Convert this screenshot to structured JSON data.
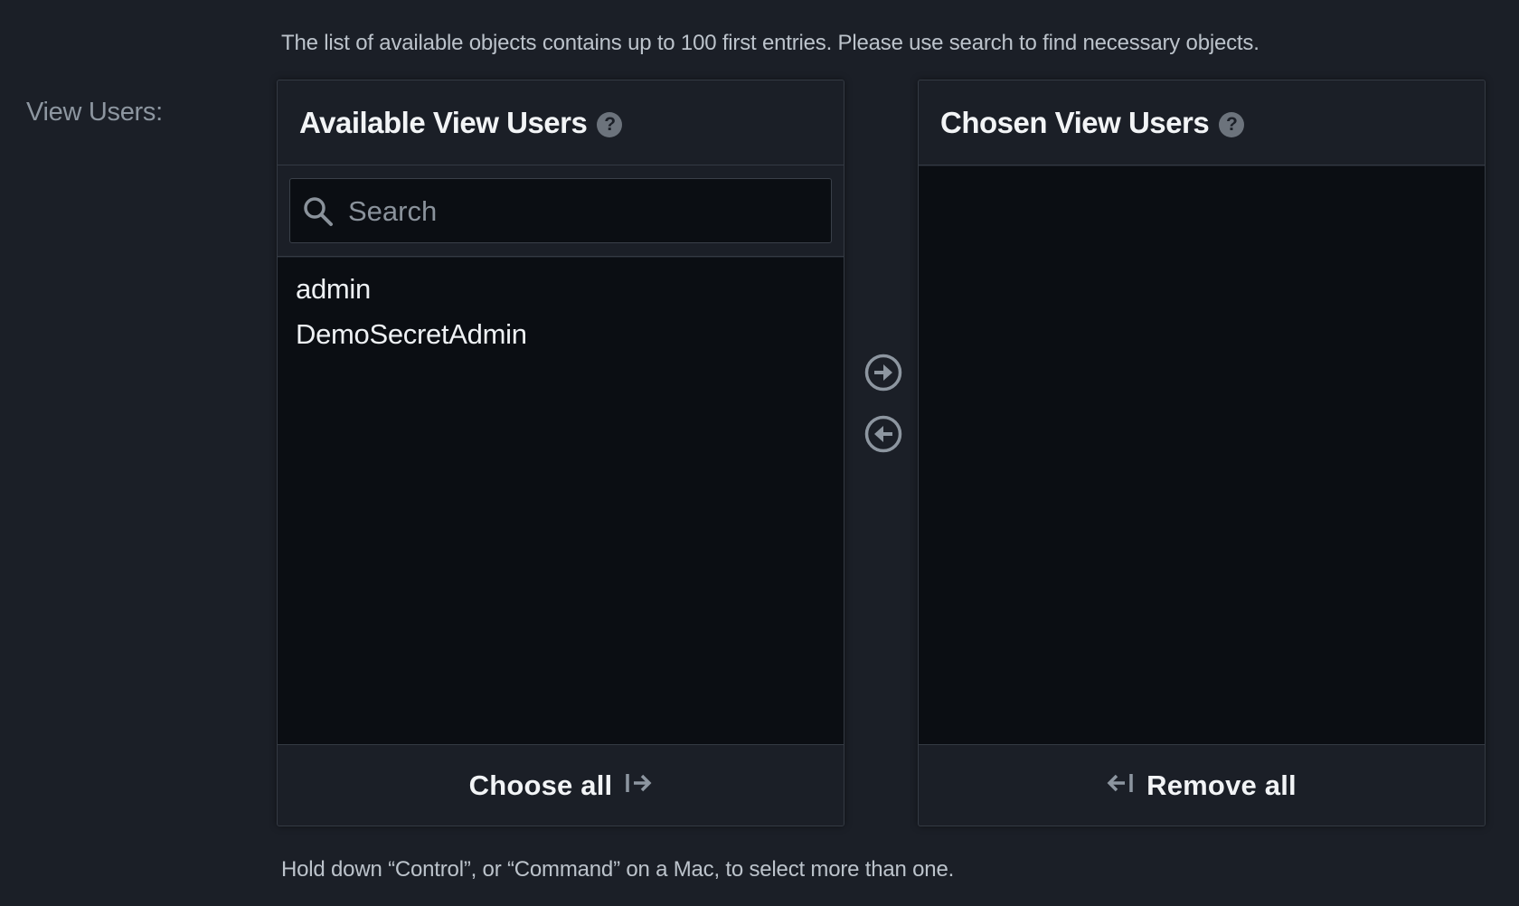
{
  "top_help": "The list of available objects contains up to 100 first entries. Please use search to find necessary objects.",
  "field_label": "View Users:",
  "available": {
    "title": "Available View Users",
    "search_placeholder": "Search",
    "items": [
      "admin",
      "DemoSecretAdmin"
    ],
    "footer_label": "Choose all"
  },
  "chosen": {
    "title": "Chosen View Users",
    "items": [],
    "footer_label": "Remove all"
  },
  "icons": {
    "help": "question-circle-icon",
    "search": "search-icon",
    "add": "arrow-right-circle-icon",
    "remove": "arrow-left-circle-icon",
    "choose_all": "arrow-right-bar-icon",
    "remove_all": "arrow-left-bar-icon"
  },
  "bottom_help": "Hold down “Control”, or “Command” on a Mac, to select more than one."
}
